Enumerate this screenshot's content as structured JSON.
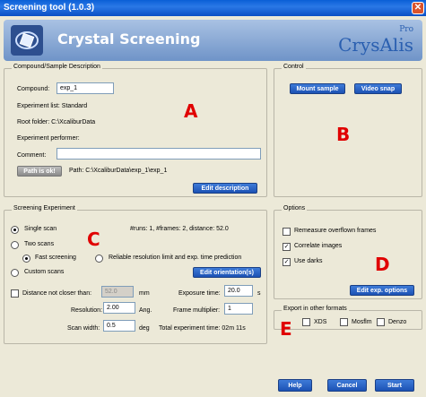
{
  "window": {
    "title": "Screening tool (1.0.3)",
    "close_glyph": "✕"
  },
  "header": {
    "title": "Crystal Screening",
    "logo_text": "CrysAlis",
    "logo_sup": "Pro",
    "icon": "crystal-icon"
  },
  "compound": {
    "legend": "Compound/Sample Description",
    "compound_label": "Compound:",
    "compound_value": "exp_1",
    "experiment_list": "Experiment list: Standard",
    "root_folder": "Root folder: C:\\XcaliburData",
    "performer": "Experiment performer:",
    "comment_label": "Comment:",
    "comment_value": "",
    "path_button": "Path is ok!",
    "path_text": "Path:  C:\\XcaliburData\\exp_1\\exp_1",
    "edit_button": "Edit description"
  },
  "control": {
    "legend": "Control",
    "mount_button": "Mount sample",
    "video_button": "Video snap"
  },
  "screening": {
    "legend": "Screening Experiment",
    "single_scan": "Single scan",
    "info": "#runs: 1, #frames: 2, distance: 52.0",
    "two_scans": "Two scans",
    "fast_screening": "Fast screening",
    "reliable": "Reliable resolution limit and exp. time prediction",
    "custom_scans": "Custom scans",
    "edit_orientation": "Edit orientation(s)",
    "distance_label": "Distance not closer than:",
    "distance_value": "52.0",
    "distance_unit": "mm",
    "exposure_label": "Exposure time:",
    "exposure_value": "20.0",
    "exposure_unit": "s",
    "resolution_label": "Resolution:",
    "resolution_value": "2.00",
    "resolution_unit": "Ang.",
    "frame_mult_label": "Frame multiplier:",
    "frame_mult_value": "1",
    "scan_width_label": "Scan width:",
    "scan_width_value": "0.5",
    "scan_width_unit": "deg",
    "total_time": "Total experiment time: 02m 11s"
  },
  "options": {
    "legend": "Options",
    "remeasure": "Remeasure overflown frames",
    "correlate": "Correlate images",
    "use_darks": "Use darks",
    "edit_button": "Edit exp. options",
    "remeasure_checked": false,
    "correlate_checked": true,
    "use_darks_checked": true
  },
  "export": {
    "legend": "Export in other formats",
    "xds": "XDS",
    "mosflm": "Mosflm",
    "denzo": "Denzo"
  },
  "footer": {
    "help": "Help",
    "cancel": "Cancel",
    "start": "Start"
  },
  "annotations": {
    "a": "A",
    "b": "B",
    "c": "C",
    "d": "D",
    "e": "E"
  },
  "colors": {
    "title_bar": "#0a5fd6",
    "button_blue": "#1c52b4",
    "annotation_red": "#e00000",
    "window_bg": "#ece9d8"
  }
}
